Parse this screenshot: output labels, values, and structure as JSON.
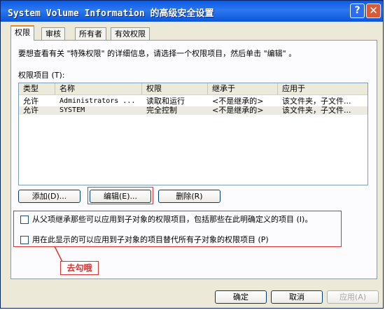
{
  "window": {
    "title": "System Volume Information 的高级安全设置"
  },
  "titlebar": {
    "help_glyph": "?",
    "close_glyph": "✕"
  },
  "tabs": [
    {
      "label": "权限",
      "active": true
    },
    {
      "label": "审核",
      "active": false
    },
    {
      "label": "所有者",
      "active": false
    },
    {
      "label": "有效权限",
      "active": false
    }
  ],
  "info_text": "要想查看有关 \"特殊权限\" 的详细信息，请选择一个权限项目，然后单击 \"编辑\" 。",
  "list_label": "权限项目 (T):",
  "columns": [
    "类型",
    "名称",
    "权限",
    "继承于",
    "应用于"
  ],
  "rows": [
    {
      "type": "允许",
      "name": "Administrators ...",
      "permission": "读取和运行",
      "inherited": "<不是继承的>",
      "applies": "该文件夹，子文件..."
    },
    {
      "type": "允许",
      "name": "SYSTEM",
      "permission": "完全控制",
      "inherited": "<不是继承的>",
      "applies": "该文件夹，子文件..."
    }
  ],
  "buttons": {
    "add": "添加(D)...",
    "edit": "编辑(E)...",
    "remove": "删除(R)",
    "ok": "确定",
    "cancel": "取消",
    "apply": "应用(A)"
  },
  "checkboxes": [
    {
      "label": "从父项继承那些可以应用到子对象的权限项目，包括那些在此明确定义的项目 (I)。",
      "checked": false
    },
    {
      "label": "用在此显示的可以应用到子对象的项目替代所有子对象的权限项目 (P)",
      "checked": false
    }
  ],
  "annotation": {
    "text": "去勾哦",
    "color": "#e03030"
  }
}
